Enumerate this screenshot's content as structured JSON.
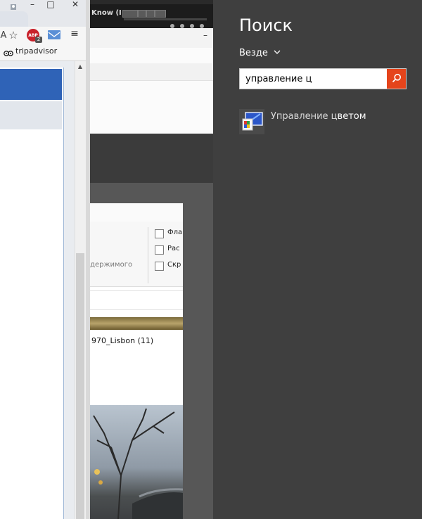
{
  "browser": {
    "bookmark_label": "tripadvisor",
    "toolbar_letter": "A",
    "abp_label": "ABP",
    "abp_badge": "2",
    "window_minimize": "–",
    "window_maximize": "□",
    "window_close": "✕",
    "menu_glyph": "≡",
    "star_glyph": "☆",
    "scroll_up_glyph": "▲"
  },
  "desktop": {
    "media_player_text": "Know (I",
    "secondary_window_minimize": "–",
    "explorer": {
      "checkbox_items": [
        {
          "label": "Фла",
          "checked": false
        },
        {
          "label": "Рас",
          "checked": false
        },
        {
          "label": "Скр",
          "checked": false
        }
      ],
      "ribbon_group_label": "одержимого",
      "file_name": "970_Lisbon (11)"
    }
  },
  "search_charm": {
    "title": "Поиск",
    "scope_label": "Везде",
    "query": "управление ц",
    "search_button_color": "#e5441b",
    "results": [
      {
        "label_prefix": "Управление ц",
        "label_rest": "ветом",
        "icon": "color-management-icon"
      }
    ]
  }
}
